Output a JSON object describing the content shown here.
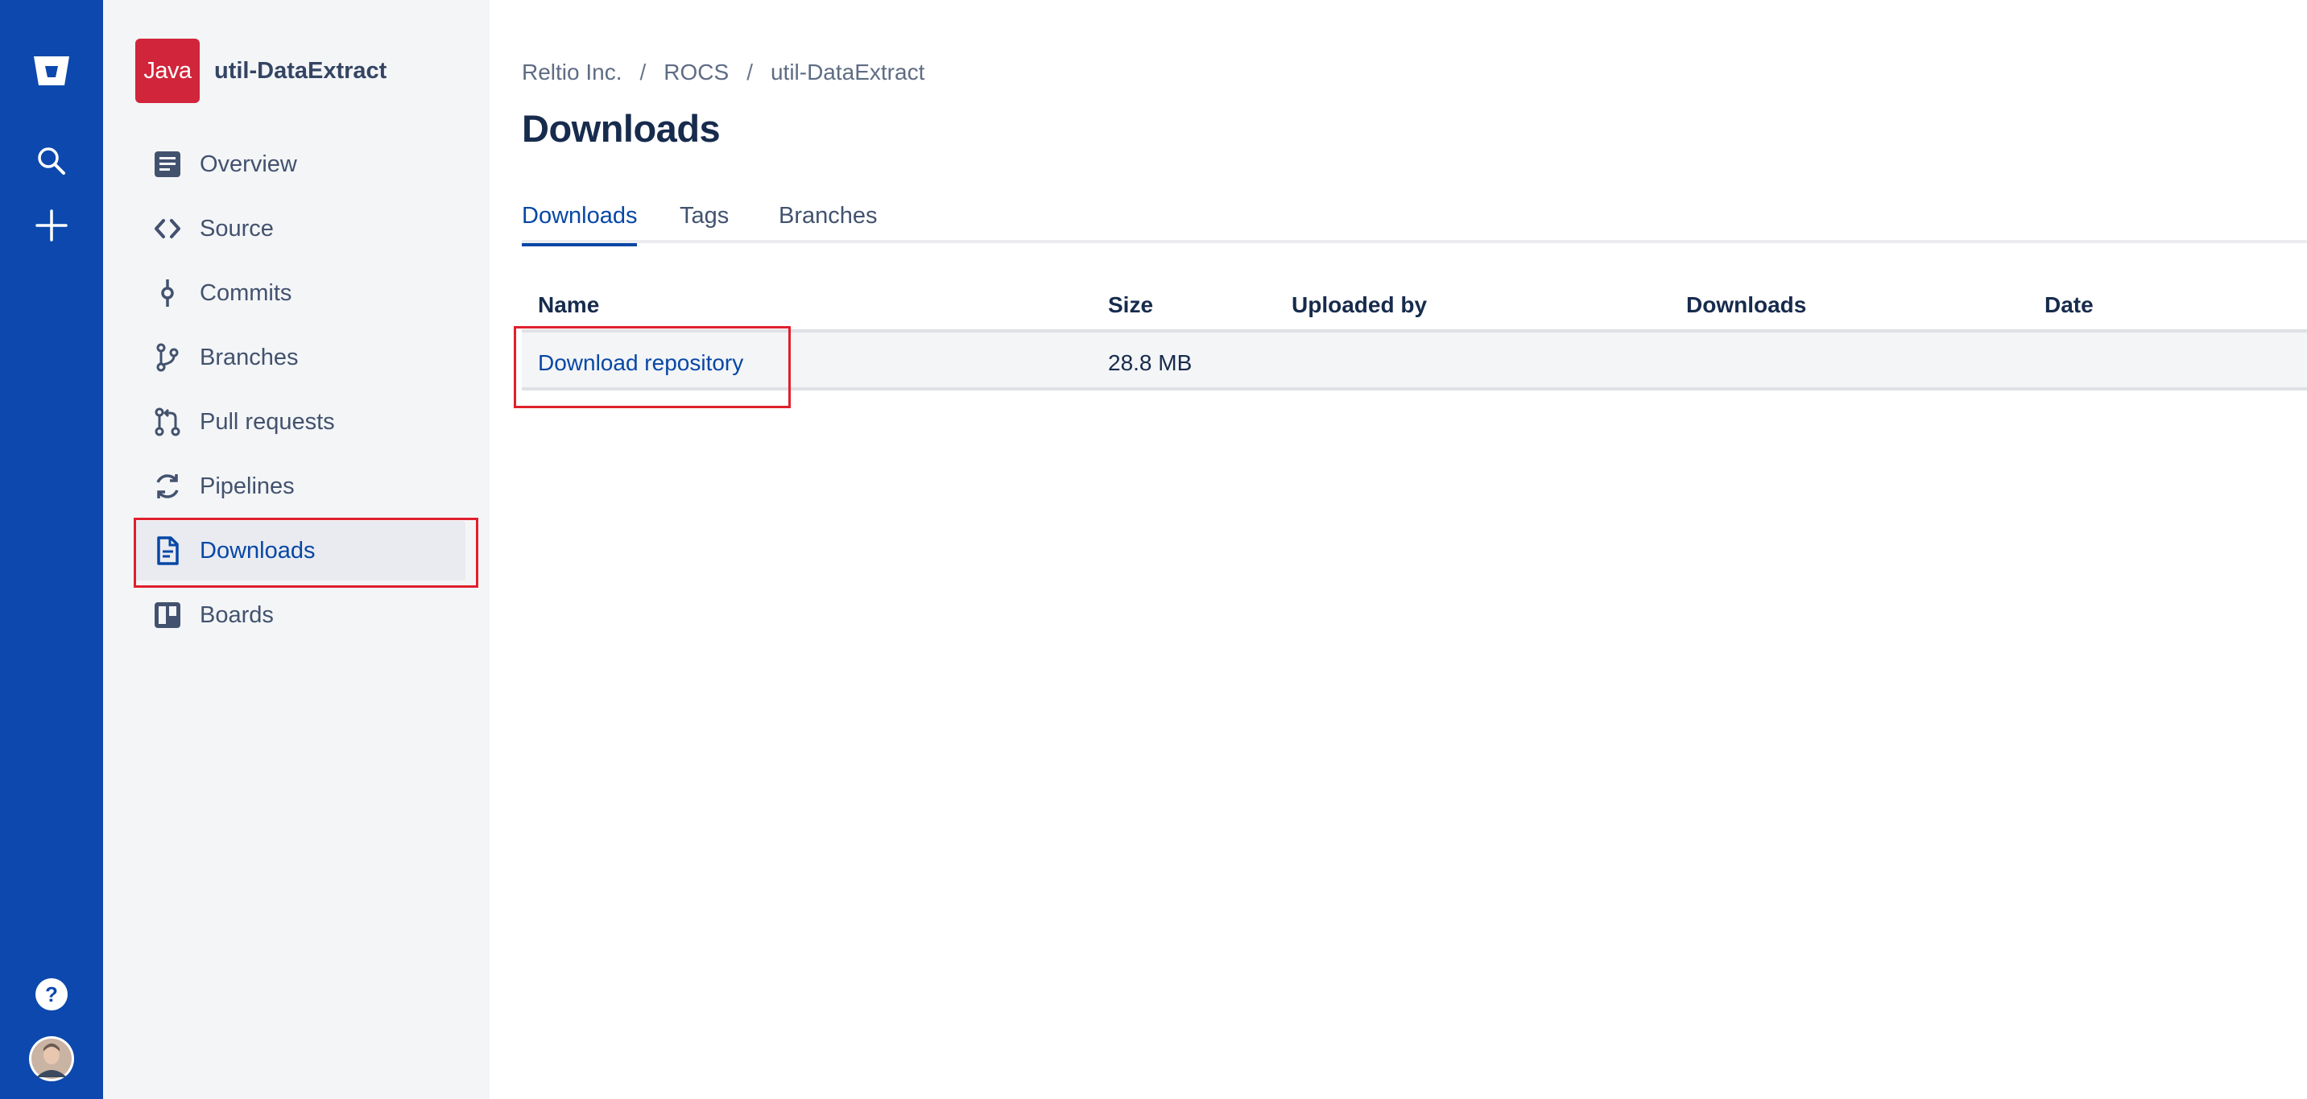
{
  "global_nav": {
    "logo_icon": "bitbucket-logo-icon",
    "search_icon": "search-icon",
    "create_icon": "plus-icon",
    "help_icon": "help-icon",
    "avatar_icon": "user-avatar"
  },
  "repo": {
    "avatar_text": "Java",
    "avatar_color": "#d0253a",
    "name": "util-DataExtract"
  },
  "sidebar": {
    "items": [
      {
        "label": "Overview",
        "icon": "overview-icon"
      },
      {
        "label": "Source",
        "icon": "code-icon"
      },
      {
        "label": "Commits",
        "icon": "commit-icon"
      },
      {
        "label": "Branches",
        "icon": "branch-icon"
      },
      {
        "label": "Pull requests",
        "icon": "pull-request-icon"
      },
      {
        "label": "Pipelines",
        "icon": "pipelines-icon"
      },
      {
        "label": "Downloads",
        "icon": "document-icon",
        "active": true
      },
      {
        "label": "Boards",
        "icon": "board-icon"
      }
    ]
  },
  "breadcrumb": {
    "items": [
      "Reltio Inc.",
      "ROCS",
      "util-DataExtract"
    ],
    "separator": "/"
  },
  "page_title": "Downloads",
  "tabs": [
    {
      "label": "Downloads",
      "active": true
    },
    {
      "label": "Tags"
    },
    {
      "label": "Branches"
    }
  ],
  "table": {
    "headers": [
      "Name",
      "Size",
      "Uploaded by",
      "Downloads",
      "Date"
    ],
    "rows": [
      {
        "name": "Download repository",
        "size": "28.8 MB",
        "uploaded_by": "",
        "downloads": "",
        "date": ""
      }
    ]
  },
  "colors": {
    "nav_bg": "#0c48ad",
    "sidebar_bg": "#f4f5f7",
    "link": "#0747a6",
    "highlight": "#e0202c"
  }
}
